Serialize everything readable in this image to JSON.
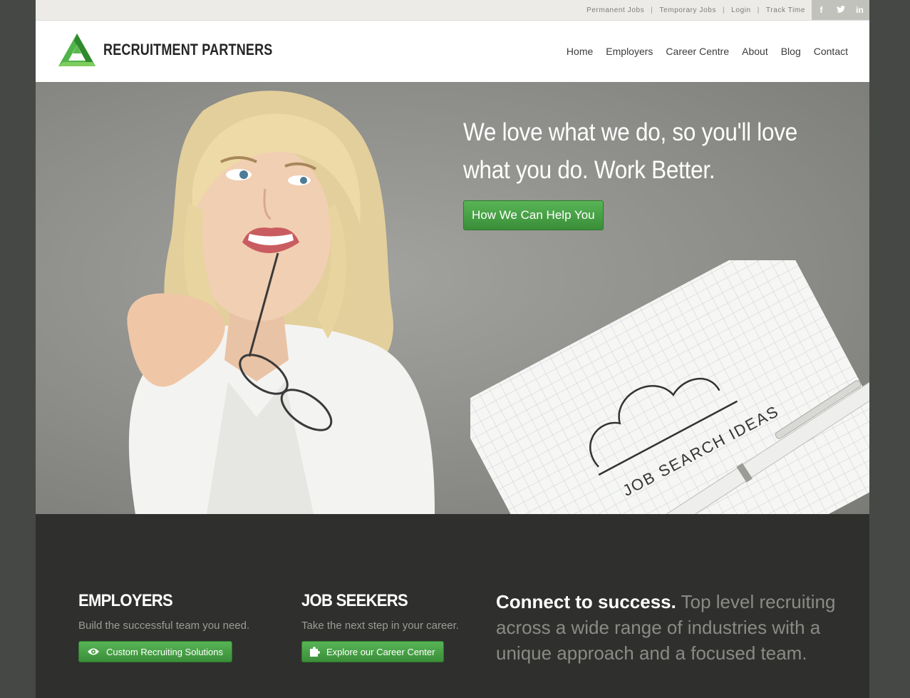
{
  "topbar": {
    "links": [
      "Permanent Jobs",
      "Temporary Jobs",
      "Login",
      "Track Time"
    ],
    "separator": "|",
    "social": [
      "f",
      "t",
      "in"
    ]
  },
  "header": {
    "brand": "RECRUITMENT PARTNERS",
    "nav": [
      "Home",
      "Employers",
      "Career Centre",
      "About",
      "Blog",
      "Contact"
    ]
  },
  "hero": {
    "headline": "We love what we do, so you'll love what you do. Work Better.",
    "cta": "How We Can Help You",
    "notepad_text": "JOB SEARCH IDEAS"
  },
  "sections": {
    "employers": {
      "title": "EMPLOYERS",
      "subtitle": "Build the successful team you need.",
      "button": "Custom Recruiting Solutions",
      "icon": "eye-icon"
    },
    "job_seekers": {
      "title": "JOB SEEKERS",
      "subtitle": "Take the next step in your career.",
      "button": "Explore our Career Center",
      "icon": "puzzle-icon"
    },
    "connect": {
      "lead": "Connect to success.",
      "body": "Top level recruiting across a wide range of industries with a unique approach and a focused team."
    }
  },
  "colors": {
    "accent_green": "#45a043",
    "dark_band": "#2f2f2d",
    "outer_bg": "#464845"
  }
}
